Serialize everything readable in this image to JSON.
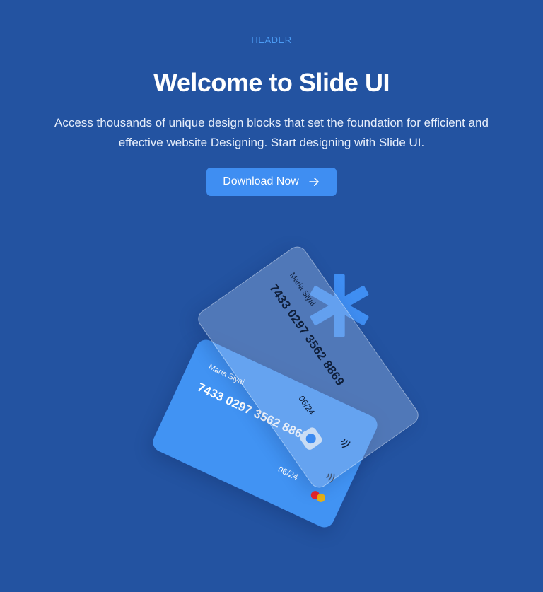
{
  "header": {
    "eyebrow": "HEADER",
    "title": "Welcome to Slide UI",
    "subtitle": "Access thousands of unique design blocks that set the foundation for efficient and effective website Designing. Start designing with Slide UI.",
    "cta_label": "Download Now"
  },
  "cards": {
    "back": {
      "name": "Maria Siyai",
      "number": "7433 0297 3562 8869",
      "expiry": "06/24"
    },
    "front": {
      "name": "Maria Siyai",
      "number": "7433 0297 3562 8869",
      "expiry": "06/24"
    }
  },
  "colors": {
    "background": "#2353a1",
    "accent": "#3f8ef2",
    "eyebrow": "#4b9cf5"
  }
}
